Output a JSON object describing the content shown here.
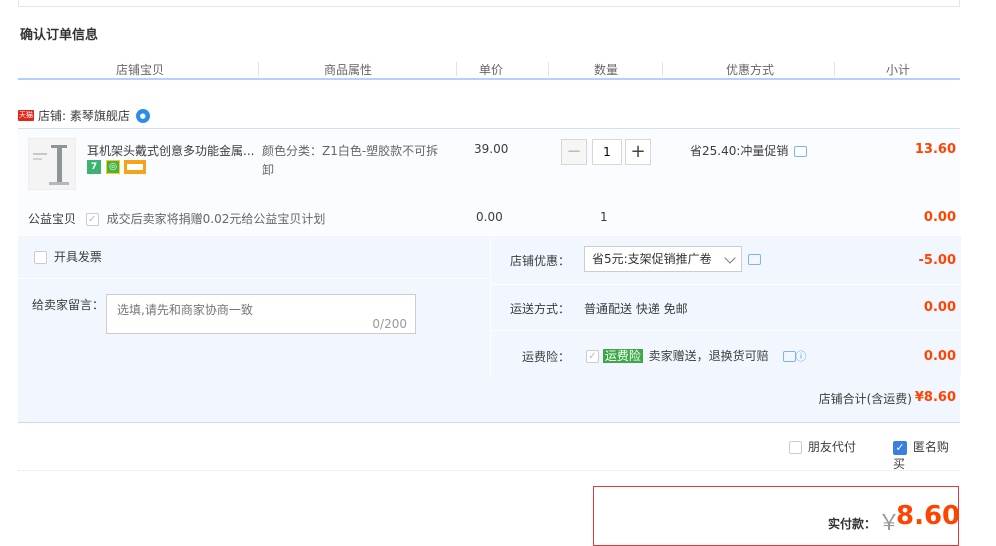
{
  "section_title": "确认订单信息",
  "columns": [
    "店铺宝贝",
    "商品属性",
    "单价",
    "数量",
    "优惠方式",
    "小计"
  ],
  "shop": {
    "label": "店铺: 素琴旗舰店",
    "tmall_badge": "天猫"
  },
  "item": {
    "title": "耳机架头戴式创意多功能金属...",
    "attributes": "颜色分类：Z1白色-塑胶款不可拆卸",
    "price": "39.00",
    "quantity": "1",
    "promotion": "省25.40:冲量促销",
    "subtotal": "13.60"
  },
  "charity": {
    "label": "公益宝贝",
    "text": "成交后卖家将捐赠0.02元给公益宝贝计划",
    "price": "0.00",
    "quantity": "1",
    "subtotal": "0.00"
  },
  "invoice_label": "开具发票",
  "message": {
    "label": "给卖家留言：",
    "placeholder": "选填,请先和商家协商一致",
    "count": "0/200"
  },
  "shop_discount": {
    "label": "店铺优惠：",
    "selected": "省5元:支架促销推广卷",
    "amount": "-5.00"
  },
  "shipping": {
    "label": "运送方式：",
    "value": "普通配送 快递 免邮",
    "amount": "0.00"
  },
  "insurance": {
    "label": "运费险：",
    "badge": "运费险",
    "text": "卖家赠送，退换货可赔",
    "amount": "0.00"
  },
  "shop_total": {
    "label": "店铺合计(含运费)",
    "amount": "¥8.60"
  },
  "options": {
    "friend_pay": "朋友代付",
    "anonymous": "匿名购买"
  },
  "pay": {
    "label": "实付款：",
    "currency": "￥",
    "amount": "8.60"
  },
  "colors": {
    "accent_red": "#ff4400",
    "header_line": "#b2d1ff",
    "panel_bg": "#f2f7ff"
  }
}
